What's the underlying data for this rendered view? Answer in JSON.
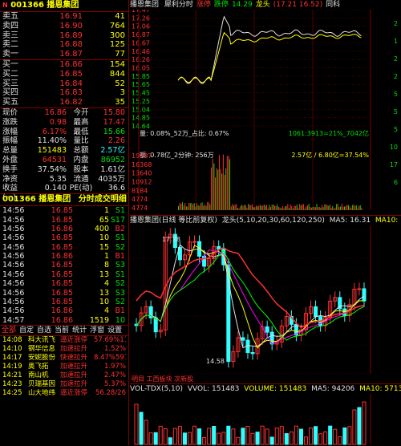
{
  "stock": {
    "code": "001366",
    "name": "播恩集团",
    "marker": "N"
  },
  "orderbook": {
    "asks": [
      {
        "label": "卖五",
        "price": "16.91",
        "vol": "41"
      },
      {
        "label": "卖四",
        "price": "16.90",
        "vol": "764"
      },
      {
        "label": "卖三",
        "price": "16.89",
        "vol": "300"
      },
      {
        "label": "卖二",
        "price": "16.88",
        "vol": "125"
      },
      {
        "label": "卖一",
        "price": "16.87",
        "vol": "77"
      }
    ],
    "bids": [
      {
        "label": "买一",
        "price": "16.86",
        "vol": "154"
      },
      {
        "label": "买二",
        "price": "16.85",
        "vol": "844"
      },
      {
        "label": "买三",
        "price": "16.84",
        "vol": "52"
      },
      {
        "label": "买四",
        "price": "16.83",
        "vol": "3"
      },
      {
        "label": "买五",
        "price": "16.82",
        "vol": "35"
      }
    ]
  },
  "stats": [
    {
      "l1": "现价",
      "v1": "16.86",
      "l2": "今开",
      "v2": "15.80"
    },
    {
      "l1": "涨跌",
      "v1": "0.98",
      "l2": "最高",
      "v2": "17.47"
    },
    {
      "l1": "涨幅",
      "v1": "6.17%",
      "l2": "最低",
      "v2": "15.66"
    },
    {
      "l1": "振幅",
      "v1": "11.40%",
      "l2": "量比",
      "v2": "2.26"
    },
    {
      "l1": "总量",
      "v1": "151483",
      "l2": "总额",
      "v2": "2.57亿"
    },
    {
      "l1": "外盘",
      "v1": "64531",
      "l2": "内盘",
      "v2": "86952"
    },
    {
      "l1": "换手",
      "v1": "37.54%",
      "l2": "股本",
      "v2": "1.61亿"
    },
    {
      "l1": "净资",
      "v1": "5.35",
      "l2": "流通",
      "v2": "4035万"
    },
    {
      "l1": "收益(一)",
      "v1": "0.140",
      "l2": "PE(动)",
      "v2": "36.6"
    }
  ],
  "ticks_header": {
    "code": "001366",
    "name": "播恩集团",
    "title": "分时成交明细"
  },
  "ticks": [
    {
      "t": "14:56",
      "p": "16.85",
      "v": "1",
      "b": "S1"
    },
    {
      "t": "14:56",
      "p": "16.85",
      "v": "65",
      "b": "S17"
    },
    {
      "t": "14:56",
      "p": "16.86",
      "v": "400",
      "b": "B2"
    },
    {
      "t": "14:56",
      "p": "16.85",
      "v": "10",
      "b": "S1"
    },
    {
      "t": "14:56",
      "p": "16.85",
      "v": "15",
      "b": "S2"
    },
    {
      "t": "14:56",
      "p": "16.86",
      "v": "1",
      "b": "B1"
    },
    {
      "t": "14:56",
      "p": "16.85",
      "v": "8",
      "b": "S3"
    },
    {
      "t": "14:56",
      "p": "16.85",
      "v": "13",
      "b": "S1"
    },
    {
      "t": "14:56",
      "p": "16.85",
      "v": "4",
      "b": "S2"
    },
    {
      "t": "14:56",
      "p": "16.85",
      "v": "13",
      "b": "S3"
    },
    {
      "t": "14:56",
      "p": "16.85",
      "v": "10",
      "b": "S2"
    },
    {
      "t": "14:56",
      "p": "16.86",
      "v": "4",
      "b": "B1"
    },
    {
      "t": "14:57",
      "p": "16.86",
      "v": "1519",
      "b": "10"
    }
  ],
  "tabs": [
    "全部",
    "自定",
    "自选",
    "当前",
    "统计",
    "浮窗",
    "设置"
  ],
  "news": [
    {
      "t": "14:08",
      "n": "科大讯飞",
      "d": "逼近涨停",
      "v": "57.69%11373"
    },
    {
      "t": "14:10",
      "n": "钢华信息",
      "d": "加速拉升",
      "v": "1.52%"
    },
    {
      "t": "14:17",
      "n": "安妮股份",
      "d": "快速拉升",
      "v": "8.47%597058"
    },
    {
      "t": "14:19",
      "n": "奥飞拓",
      "d": "加速拉升",
      "v": "1.97%"
    },
    {
      "t": "14:21",
      "n": "南山机",
      "d": "加速拉升",
      "v": "2.47%"
    },
    {
      "t": "14:23",
      "n": "贝瑞基因",
      "d": "加速拉升",
      "v": "5.37%"
    },
    {
      "t": "14:25",
      "n": "山大地纬",
      "d": "逼近涨停",
      "v": "56.28/26"
    }
  ],
  "intraday": {
    "title_name": "播恩集团",
    "header_items": [
      "犀利分时",
      "涨停",
      "跌停",
      "14.29",
      "龙头",
      "(17.21 16.52)",
      "同科"
    ],
    "price_ticks": [
      "17.47",
      "17.26",
      "17.06",
      "16.87",
      "16.67",
      "16.46",
      "16.26",
      "16.05",
      "15.85",
      "15.65",
      "15.45",
      "15.25",
      "15.04",
      "14.85",
      "14.64"
    ],
    "vol_ticks": [
      "19097",
      "16368",
      "13640",
      "10912",
      "8184",
      "4774",
      "4774"
    ],
    "info1": "量: 0.08%_52万_占比: 0.67%",
    "info1r": "1061:3913=21%_7042亿",
    "info2": "额: 0.78亿_2分钟: 256万",
    "info2r": "2.57亿 / 6.80亿=37.54%",
    "right_labels": [
      "2",
      "1",
      "2",
      "2",
      "5",
      "5",
      "5",
      "10",
      "17",
      "6"
    ]
  },
  "kline": {
    "header": "播恩集团(日线 等比前复权)",
    "ma_label": "龙头(5,10,20,30,60,120,250)",
    "ma5": "MA5: 16.31",
    "ma10": "MA10: 15.9",
    "high_label": "17.78",
    "low_label": "14.58",
    "bottom_tags": "明目  工西板块  次新股",
    "time_axis": [
      "09:30",
      "10:30",
      "13:00",
      "14:00",
      "15:00"
    ]
  },
  "volume_panel": {
    "label": "VOL-TDX(5,10)",
    "vvol": "VVOL: 151483",
    "volume": "VOLUME: 151483",
    "ma5": "MA5: 94206",
    "ma10": "MA10: 57138"
  },
  "colors": {
    "up": "#ff3030",
    "down": "#00e000",
    "bg": "#000000",
    "grid": "#800000",
    "yellow": "#ffff00",
    "cyan": "#30ffff"
  }
}
